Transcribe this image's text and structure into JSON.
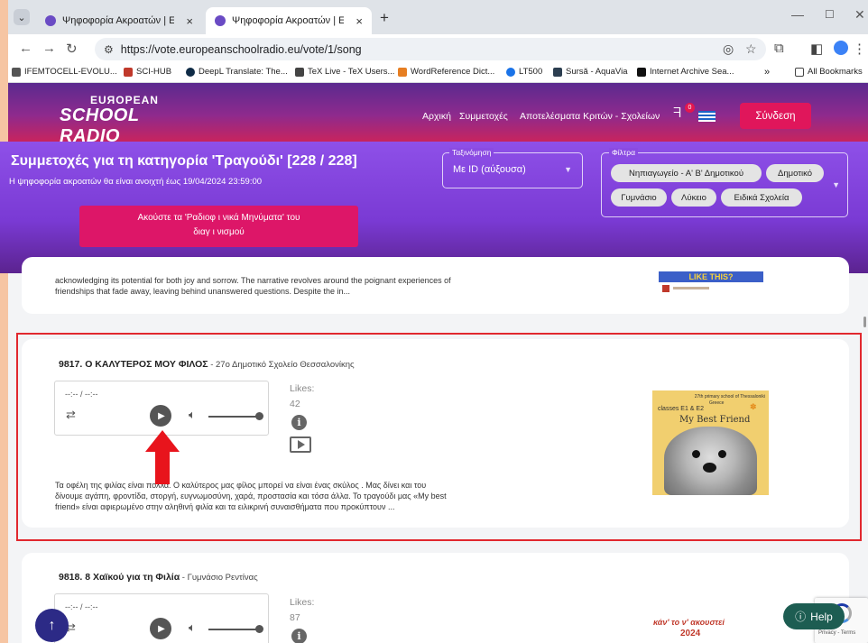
{
  "browser": {
    "tabs": [
      {
        "title": "Ψηφοφορία Ακροατών | Europ",
        "close": "×"
      },
      {
        "title": "Ψηφοφορία Ακροατών | Europ",
        "close": "×"
      }
    ],
    "new_tab": "+",
    "url": "https://vote.europeanschoolradio.eu/vote/1/song",
    "bookmarks": [
      {
        "label": "IFEMTOCELL-EVOLU...",
        "color": "#555555"
      },
      {
        "label": "SCI-HUB",
        "color": "#c0392b"
      },
      {
        "label": "DeepL Translate: The...",
        "color": "#0f2b46"
      },
      {
        "label": "TeX Live - TeX Users...",
        "color": "#444444"
      },
      {
        "label": "WordReference Dict...",
        "color": "#e67e22"
      },
      {
        "label": "LT500",
        "color": "#1a73e8"
      },
      {
        "label": "Sursă - AquaVia",
        "color": "#2c3e50"
      },
      {
        "label": "Internet Archive Sea...",
        "color": "#111111"
      }
    ],
    "all_bookmarks": "All Bookmarks",
    "overflow": "»"
  },
  "header": {
    "logo_line1": "EUЯOPEAN",
    "logo_line2": "SCHOOL RADIO",
    "nav": [
      "Αρχική",
      "Συμμετοχές",
      "Αποτελέσματα Κριτών - Σχολείων"
    ],
    "notification_count": "0",
    "signin_label": "Σύνδεση"
  },
  "banner": {
    "title": "Συμμετοχές για τη κατηγορία 'Τραγούδι' [228 / 228]",
    "subtitle": "Η ψηφοφορία ακροατών θα είναι ανοιχτή έως 19/04/2024 23:59:00",
    "message_button_line1": "Ακούστε τα 'Ραδιοφ ι νικά Μηνύματα' του",
    "message_button_line2": "διαγ ι νισμού",
    "sort_legend": "Ταξινόμηση",
    "sort_value": "Με ID (αύξουσα)",
    "filter_legend": "Φίλτρα",
    "filters": [
      "Νηπιαγωγείο - Α' Β' Δημοτικού",
      "Δημοτικό",
      "Γυμνάσιο",
      "Λύκειο",
      "Ειδικά Σχολεία"
    ]
  },
  "entries": {
    "previous": {
      "text_line1": "acknowledging its potential for both joy and sorrow. The narrative revolves around the poignant experiences of",
      "text_line2": "friendships that fade away, leaving behind unanswered questions. Despite the in...",
      "thumb_text": "LIKE THIS?"
    },
    "current": {
      "title": "9817. Ο ΚΑΛΥΤΕΡΟΣ ΜΟΥ ΦΙΛΟΣ",
      "school": " - 27ο Δημοτικό Σχολείο Θεσσαλονίκης",
      "time": "--:-- / --:--",
      "likes_label": "Likes:",
      "likes": "42",
      "text_line1": "Τα οφέλη της φιλίας είναι πολλά. Ο καλύτερος μας φίλος μπορεί να είναι ένας σκύλος . Μας δίνει και του",
      "text_line2": "δίνουμε αγάπη, φροντίδα, στοργή, ευγνωμοσύνη, χαρά, προστασία και τόσα άλλα. Το τραγούδι μας «My best",
      "text_line3": "friend» είναι αφιερωμένο στην αληθινή φιλία και τα ειλικρινή συναισθήματα που προκύπτουν ...",
      "thumb_line1": "27th primary school of Thessaloniki",
      "thumb_line2": "Greece",
      "thumb_line3": "classes E1 & E2",
      "thumb_title": "My Best Friend"
    },
    "next": {
      "title": "9818. 8 Χαϊκού για τη Φιλία",
      "school": " - Γυμνάσιο Ρεντίνας",
      "time": "--:-- / --:--",
      "likes_label": "Likes:",
      "likes": "87",
      "thumb_text": "κάν' το ν' ακουστεί",
      "thumb_year": "2024"
    }
  },
  "help_label": "Help",
  "recaptcha_text": "Privacy - Terms",
  "colors": {
    "accent": "#e0165b",
    "banner": "#7a3ad4",
    "highlight": "#e1282e",
    "help": "#1d5d52"
  }
}
